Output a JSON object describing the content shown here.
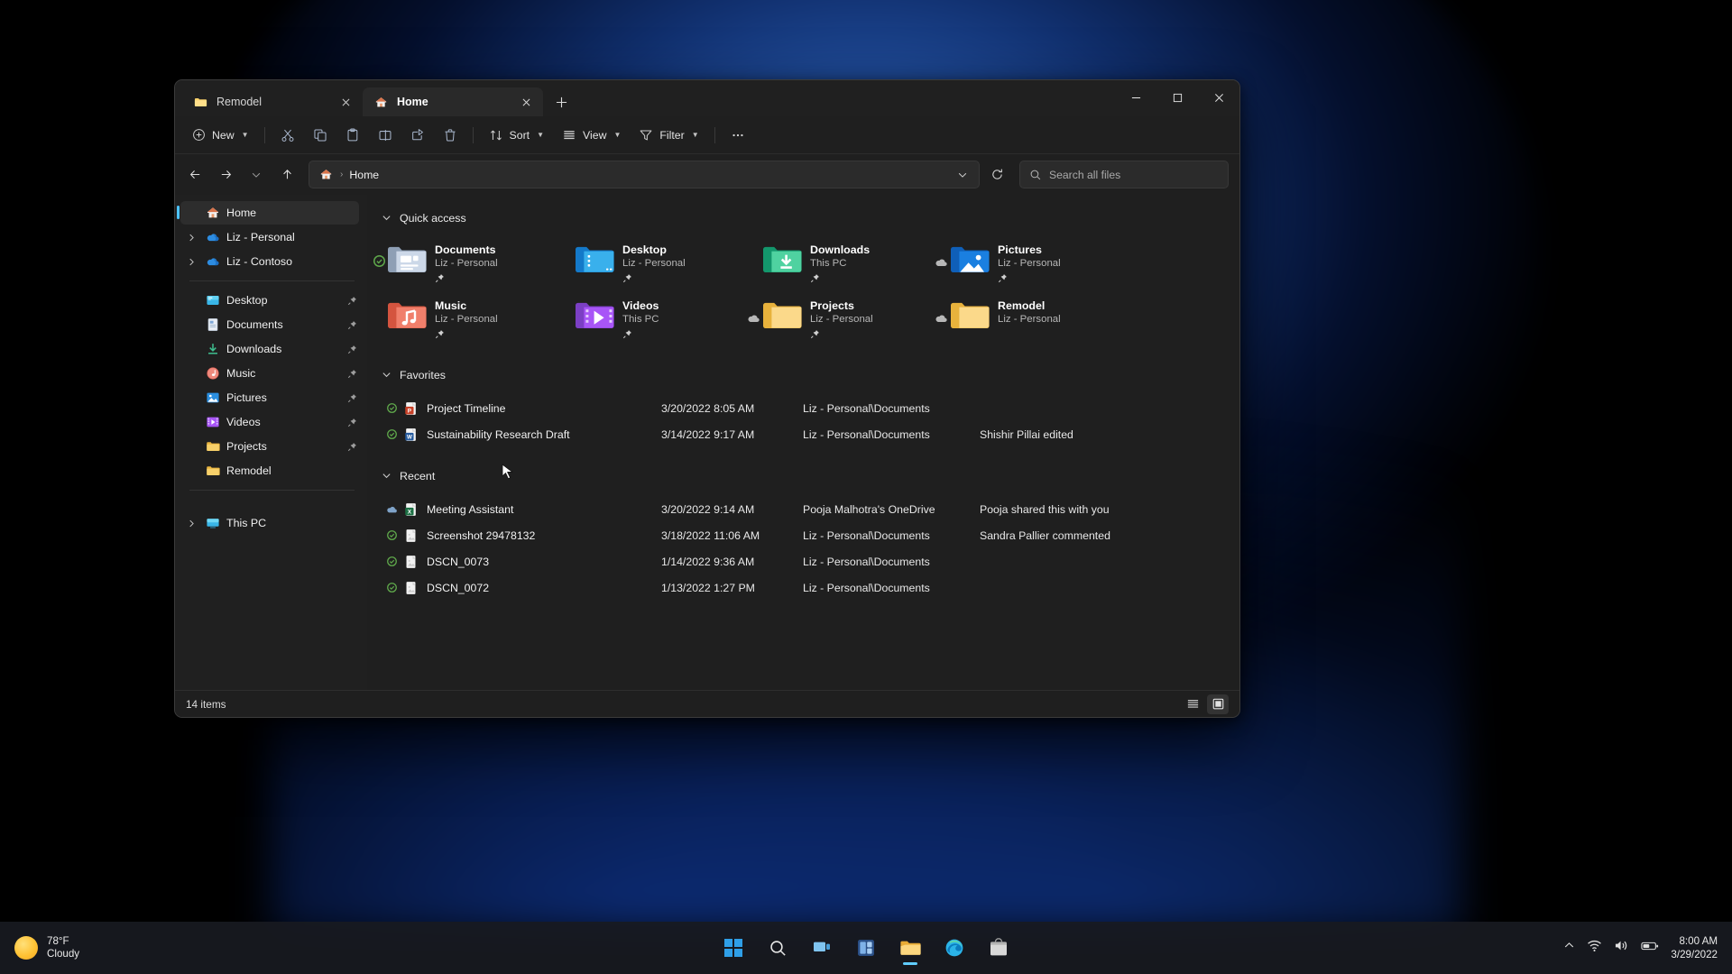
{
  "window": {
    "tabs": [
      {
        "label": "Remodel",
        "icon": "folder-icon",
        "active": false
      },
      {
        "label": "Home",
        "icon": "home-icon",
        "active": true
      }
    ],
    "new_tab_label": "+",
    "controls": {
      "minimize": "Minimize",
      "maximize": "Maximize",
      "close": "Close"
    }
  },
  "toolbar": {
    "new_label": "New",
    "cut_label": "Cut",
    "copy_label": "Copy",
    "paste_label": "Paste",
    "rename_label": "Rename",
    "share_label": "Share",
    "delete_label": "Delete",
    "sort_label": "Sort",
    "view_label": "View",
    "filter_label": "Filter",
    "more_label": "…"
  },
  "address": {
    "back_label": "Back",
    "forward_label": "Forward",
    "recent_label": "Recent locations",
    "up_label": "Up",
    "crumb_home": "Home",
    "crumb_sep": "›",
    "refresh_label": "Refresh"
  },
  "search": {
    "placeholder": "Search all files"
  },
  "sidebar": {
    "items": [
      {
        "label": "Home",
        "icon": "home-icon",
        "expander": "",
        "selected": true,
        "pinned": false
      },
      {
        "label": "Liz - Personal",
        "icon": "onedrive-icon",
        "expander": "›",
        "selected": false,
        "pinned": false
      },
      {
        "label": "Liz - Contoso",
        "icon": "onedrive-icon",
        "expander": "›",
        "selected": false,
        "pinned": false
      }
    ],
    "pinned": [
      {
        "label": "Desktop",
        "icon": "desktop-icon",
        "pinned": true
      },
      {
        "label": "Documents",
        "icon": "documents-icon",
        "pinned": true
      },
      {
        "label": "Downloads",
        "icon": "downloads-icon",
        "pinned": true
      },
      {
        "label": "Music",
        "icon": "music-icon",
        "pinned": true
      },
      {
        "label": "Pictures",
        "icon": "pictures-icon",
        "pinned": true
      },
      {
        "label": "Videos",
        "icon": "videos-icon",
        "pinned": true
      },
      {
        "label": "Projects",
        "icon": "folder-icon",
        "pinned": true
      },
      {
        "label": "Remodel",
        "icon": "folder-icon",
        "pinned": false
      }
    ],
    "devices": [
      {
        "label": "This PC",
        "icon": "thispc-icon",
        "expander": "›"
      }
    ]
  },
  "main": {
    "quick_access": {
      "title": "Quick access",
      "chevron": "⌄",
      "tiles": [
        {
          "name": "Documents",
          "sub": "Liz - Personal",
          "icon": "documents-folder-icon",
          "badge": "synced",
          "pinned": true
        },
        {
          "name": "Desktop",
          "sub": "Liz - Personal",
          "icon": "desktop-folder-icon",
          "badge": "none",
          "pinned": true
        },
        {
          "name": "Downloads",
          "sub": "This PC",
          "icon": "downloads-folder-icon",
          "badge": "none",
          "pinned": true
        },
        {
          "name": "Pictures",
          "sub": "Liz - Personal",
          "icon": "pictures-folder-icon",
          "badge": "cloud",
          "pinned": true
        },
        {
          "name": "Music",
          "sub": "Liz - Personal",
          "icon": "music-folder-icon",
          "badge": "none",
          "pinned": true
        },
        {
          "name": "Videos",
          "sub": "This PC",
          "icon": "videos-folder-icon",
          "badge": "none",
          "pinned": true
        },
        {
          "name": "Projects",
          "sub": "Liz - Personal",
          "icon": "folder-icon",
          "badge": "cloud",
          "pinned": true
        },
        {
          "name": "Remodel",
          "sub": "Liz - Personal",
          "icon": "folder-icon",
          "badge": "cloud",
          "pinned": false
        }
      ]
    },
    "favorites": {
      "title": "Favorites",
      "chevron": "⌄",
      "rows": [
        {
          "name": "Project Timeline",
          "date": "3/20/2022 8:05 AM",
          "location": "Liz - Personal\\Documents",
          "activity": "",
          "icon": "powerpoint-icon",
          "status": "synced"
        },
        {
          "name": "Sustainability Research Draft",
          "date": "3/14/2022 9:17 AM",
          "location": "Liz - Personal\\Documents",
          "activity": "Shishir Pillai edited",
          "icon": "word-icon",
          "status": "synced"
        }
      ]
    },
    "recent": {
      "title": "Recent",
      "chevron": "⌄",
      "rows": [
        {
          "name": "Meeting Assistant",
          "date": "3/20/2022 9:14 AM",
          "location": "Pooja Malhotra's OneDrive",
          "activity": "Pooja shared this with you",
          "icon": "excel-icon",
          "status": "cloud"
        },
        {
          "name": "Screenshot 29478132",
          "date": "3/18/2022 11:06 AM",
          "location": "Liz - Personal\\Documents",
          "activity": "Sandra Pallier commented",
          "icon": "image-icon",
          "status": "synced"
        },
        {
          "name": "DSCN_0073",
          "date": "1/14/2022 9:36 AM",
          "location": "Liz - Personal\\Documents",
          "activity": "",
          "icon": "image-icon",
          "status": "synced"
        },
        {
          "name": "DSCN_0072",
          "date": "1/13/2022 1:27 PM",
          "location": "Liz - Personal\\Documents",
          "activity": "",
          "icon": "image-icon",
          "status": "synced"
        }
      ]
    }
  },
  "statusbar": {
    "item_count": "14 items",
    "details_view_label": "Details view",
    "large_icons_label": "Large icons view"
  },
  "taskbar": {
    "weather": {
      "temperature": "78°F",
      "condition": "Cloudy"
    },
    "apps": [
      {
        "name": "start-button",
        "label": "Start"
      },
      {
        "name": "search-button",
        "label": "Search"
      },
      {
        "name": "task-view-button",
        "label": "Task view"
      },
      {
        "name": "widgets-button",
        "label": "Widgets"
      },
      {
        "name": "file-explorer-button",
        "label": "File Explorer"
      },
      {
        "name": "edge-button",
        "label": "Microsoft Edge"
      },
      {
        "name": "store-button",
        "label": "Microsoft Store"
      }
    ],
    "tray": {
      "chevron": "⌃",
      "network": "wifi-icon",
      "volume": "volume-icon",
      "battery": "battery-icon"
    },
    "clock": {
      "time": "8:00 AM",
      "date": "3/29/2022"
    }
  },
  "colors": {
    "accent": "#4cc2ff",
    "window_bg": "#1f1f1f",
    "sidebar_bg": "#202020",
    "sync_green": "#6aa84f"
  }
}
